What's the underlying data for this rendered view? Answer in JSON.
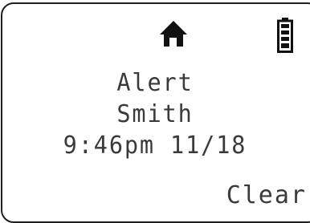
{
  "status_bar": {
    "icons": [
      "home-icon",
      "battery-full-icon"
    ]
  },
  "message": {
    "title": "Alert",
    "name": "Smith",
    "timestamp": "9:46pm 11/18"
  },
  "softkey": {
    "right_label": "Clear"
  },
  "colors": {
    "text": "#3a3a3a",
    "icon": "#111111",
    "border": "#1f1f1f",
    "background": "#ffffff"
  }
}
